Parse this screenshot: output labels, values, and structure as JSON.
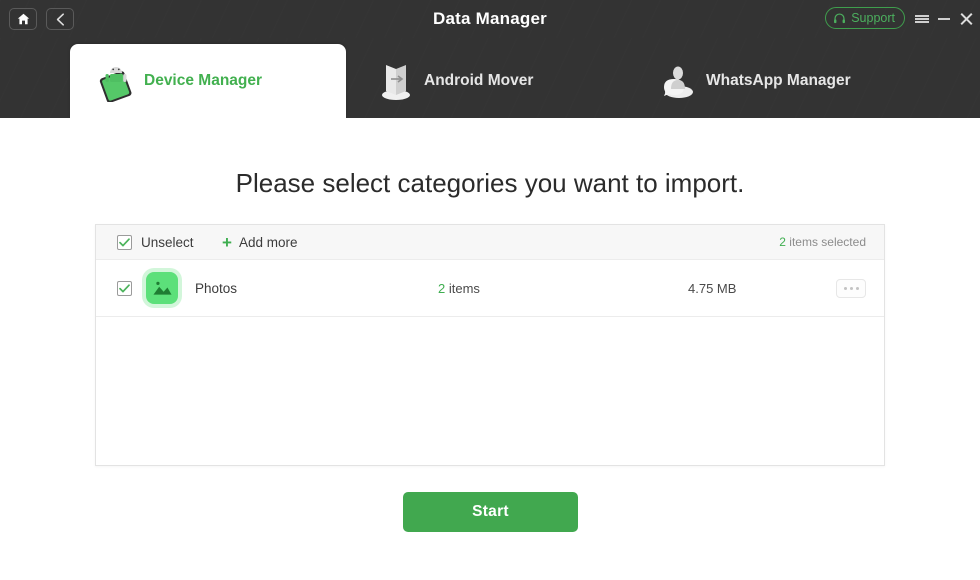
{
  "window": {
    "title": "Data Manager",
    "home_icon": "home-icon",
    "back_icon": "chevron-left-icon",
    "support_label": "Support",
    "support_icon": "headset-icon",
    "menu_icon": "hamburger-menu-icon",
    "minimize_icon": "minimize-icon",
    "close_icon": "close-icon",
    "accent_color": "#41a84f",
    "titlebar_color": "#333333"
  },
  "tabs": [
    {
      "label": "Device Manager",
      "icon": "phone-android-icon",
      "active": true
    },
    {
      "label": "Android Mover",
      "icon": "folder-transfer-icon",
      "active": false
    },
    {
      "label": "WhatsApp Manager",
      "icon": "chat-bubble-icon",
      "active": false
    }
  ],
  "main": {
    "headline": "Please select categories you want to import.",
    "card": {
      "header": {
        "select_all_label": "Unselect",
        "select_all_checked": true,
        "add_more_label": "Add more",
        "add_more_icon": "plus-icon",
        "selected_count": "2",
        "selected_suffix": " items selected"
      },
      "columns": [
        "name",
        "items",
        "size",
        "actions"
      ],
      "rows": [
        {
          "checked": true,
          "icon": "photos-image-icon",
          "name": "Photos",
          "items_count": "2",
          "items_suffix": " items",
          "size": "4.75 MB",
          "more_icon": "ellipsis-icon"
        }
      ]
    },
    "start_label": "Start"
  }
}
